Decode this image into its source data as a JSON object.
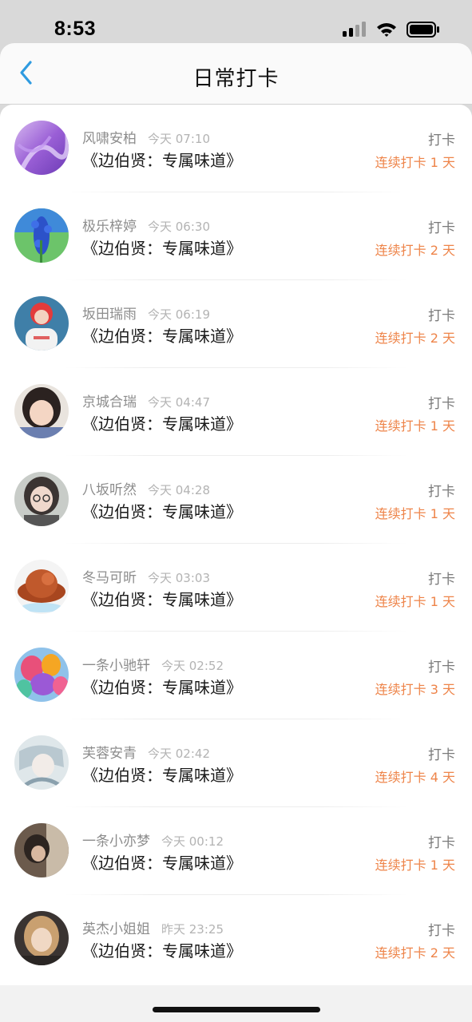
{
  "status_bar": {
    "time": "8:53",
    "icons": [
      "signal-icon",
      "wifi-icon",
      "battery-icon"
    ]
  },
  "header": {
    "title": "日常打卡",
    "back_icon": "chevron-left-icon"
  },
  "colors": {
    "accent_blue": "#2f9be0",
    "streak_orange": "#ee8449"
  },
  "checkins": [
    {
      "name": "风啸安柏",
      "time": "今天 07:10",
      "content": "《边伯贤：专属味道》",
      "action": "打卡",
      "streak": "连续打卡 1 天"
    },
    {
      "name": "极乐梓婷",
      "time": "今天 06:30",
      "content": "《边伯贤：专属味道》",
      "action": "打卡",
      "streak": "连续打卡 2 天"
    },
    {
      "name": "坂田瑞雨",
      "time": "今天 06:19",
      "content": "《边伯贤：专属味道》",
      "action": "打卡",
      "streak": "连续打卡 2 天"
    },
    {
      "name": "京城合瑞",
      "time": "今天 04:47",
      "content": "《边伯贤：专属味道》",
      "action": "打卡",
      "streak": "连续打卡 1 天"
    },
    {
      "name": "八坂听然",
      "time": "今天 04:28",
      "content": "《边伯贤：专属味道》",
      "action": "打卡",
      "streak": "连续打卡 1 天"
    },
    {
      "name": "冬马可昕",
      "time": "今天 03:03",
      "content": "《边伯贤：专属味道》",
      "action": "打卡",
      "streak": "连续打卡 1 天"
    },
    {
      "name": "一条小驰轩",
      "time": "今天 02:52",
      "content": "《边伯贤：专属味道》",
      "action": "打卡",
      "streak": "连续打卡 3 天"
    },
    {
      "name": "芙蓉安青",
      "time": "今天 02:42",
      "content": "《边伯贤：专属味道》",
      "action": "打卡",
      "streak": "连续打卡 4 天"
    },
    {
      "name": "一条小亦梦",
      "time": "今天 00:12",
      "content": "《边伯贤：专属味道》",
      "action": "打卡",
      "streak": "连续打卡 1 天"
    },
    {
      "name": "英杰小姐姐",
      "time": "昨天 23:25",
      "content": "《边伯贤：专属味道》",
      "action": "打卡",
      "streak": "连续打卡 2 天"
    }
  ]
}
